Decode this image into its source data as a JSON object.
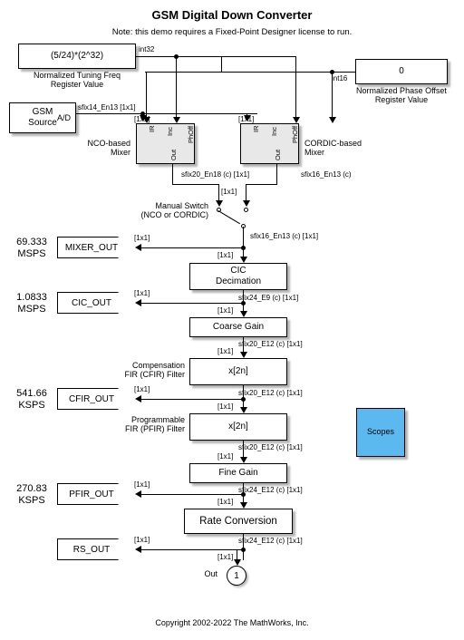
{
  "header": {
    "title": "GSM Digital Down Converter",
    "note": "Note: this demo requires a Fixed-Point Designer license to run."
  },
  "footer": {
    "copyright": "Copyright 2002-2022 The MathWorks, Inc."
  },
  "blocks": {
    "tuning_freq_const": {
      "value": "(5/24)*(2^32)",
      "caption": "Normalized Tuning Freq\nRegister Value",
      "out_type": "int32"
    },
    "phase_offset_const": {
      "value": "0",
      "caption": "Normalized Phase Offset\nRegister Value",
      "out_type": "int16"
    },
    "gsm_source": {
      "label": "GSM\nSource",
      "port_label": "A/D",
      "out_type": "sfix14_En13 [1x1]"
    },
    "nco_mixer": {
      "caption": "NCO-based\nMixer",
      "in_ports": [
        "IR",
        "Inc",
        "PhOff"
      ],
      "out_port": "Out",
      "out_type": "sfix20_En18 (c) [1x1]"
    },
    "cordic_mixer": {
      "caption": "CORDIC-based\nMixer",
      "in_ports": [
        "IR",
        "Inc",
        "PhOff"
      ],
      "out_port": "Out",
      "out_type": "sfix16_En13 (c)"
    },
    "manual_switch": {
      "caption": "Manual Switch\n(NCO or CORDIC)",
      "out_type": "sfix16_En13 (c) [1x1]"
    },
    "cic": {
      "label": "CIC\nDecimation",
      "out_type": "sfix24_E9 (c) [1x1]"
    },
    "coarse_gain": {
      "label": "Coarse Gain",
      "out_type": "sfix20_E12 (c) [1x1]"
    },
    "cfir": {
      "label": "x[2n]",
      "caption": "Compensation\nFIR (CFIR) Filter",
      "out_type": "sfix20_E12 (c) [1x1]"
    },
    "pfir": {
      "label": "x[2n]",
      "caption": "Programmable\nFIR (PFIR) Filter",
      "out_type": "sfix20_E12 (c) [1x1]"
    },
    "fine_gain": {
      "label": "Fine Gain",
      "out_type": "sfix24_E12 (c) [1x1]"
    },
    "rate_conversion": {
      "label": "Rate Conversion",
      "out_type": "sfix24_E12 (c) [1x1]"
    },
    "scopes": {
      "label": "Scopes",
      "color": "#5cb9ef"
    },
    "out_port": {
      "label": "Out",
      "number": "1"
    }
  },
  "taps": [
    {
      "name": "mixer_out",
      "label": "MIXER_OUT",
      "rate": "69.333\nMSPS"
    },
    {
      "name": "cic_out",
      "label": "CIC_OUT",
      "rate": "1.0833\nMSPS"
    },
    {
      "name": "cfir_out",
      "label": "CFIR_OUT",
      "rate": "541.66\nKSPS"
    },
    {
      "name": "pfir_out",
      "label": "PFIR_OUT",
      "rate": "270.83\nKSPS"
    },
    {
      "name": "rs_out",
      "label": "RS_OUT",
      "rate": ""
    }
  ],
  "dims": {
    "d1": "[1x1]"
  }
}
